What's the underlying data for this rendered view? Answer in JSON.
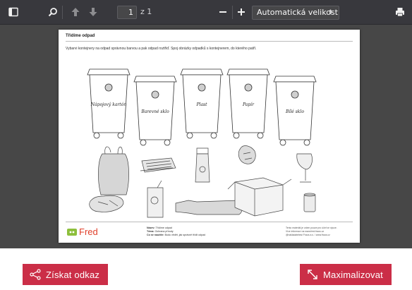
{
  "toolbar": {
    "current_page": "1",
    "page_count": "z 1",
    "zoom_value": "Automatická velikost",
    "icons": [
      "sidebar-toggle-icon",
      "search-icon",
      "arrow-up-icon",
      "arrow-down-icon",
      "zoom-out-icon",
      "zoom-in-icon",
      "print-icon"
    ]
  },
  "worksheet": {
    "title": "Třídíme odpad",
    "instruction": "Vybarvi kontejnery na odpad správnou barvou a pak odpad roztřiď. Spoj obrázky odpadků s kontejnerem, do kterého patří.",
    "bins": [
      {
        "label": "Nápojový kartón",
        "color": "#cfcfcf"
      },
      {
        "label": "Barevné sklo",
        "color": "#cfcfcf"
      },
      {
        "label": "Plast",
        "color": "#cfcfcf"
      },
      {
        "label": "Papír",
        "color": "#cfcfcf"
      },
      {
        "label": "Bílé sklo",
        "color": "#cfcfcf"
      }
    ],
    "logo_text": "Fred",
    "meta": {
      "line1_label": "Název:",
      "line1_value": "Třídíme odpad",
      "line2_label": "Téma:",
      "line2_value": "Ochrana přírody",
      "line3_label": "Co se naučíte:",
      "line3_value": "Budu vědět, jak správně třídit odpad"
    },
    "credit": [
      "Tento materiál je určen pouze pro účel ve výuce.",
      "Více informací na www.fred.fraus.cz",
      "@nakladatelstvi Fraus a.s. / www.fraus.cz"
    ]
  },
  "actions": {
    "get_link_label": "Získat odkaz",
    "maximize_label": "Maximalizovat"
  },
  "colors": {
    "toolbar_bg": "#38383d",
    "viewer_bg": "#474747",
    "accent": "#cb2e47"
  }
}
